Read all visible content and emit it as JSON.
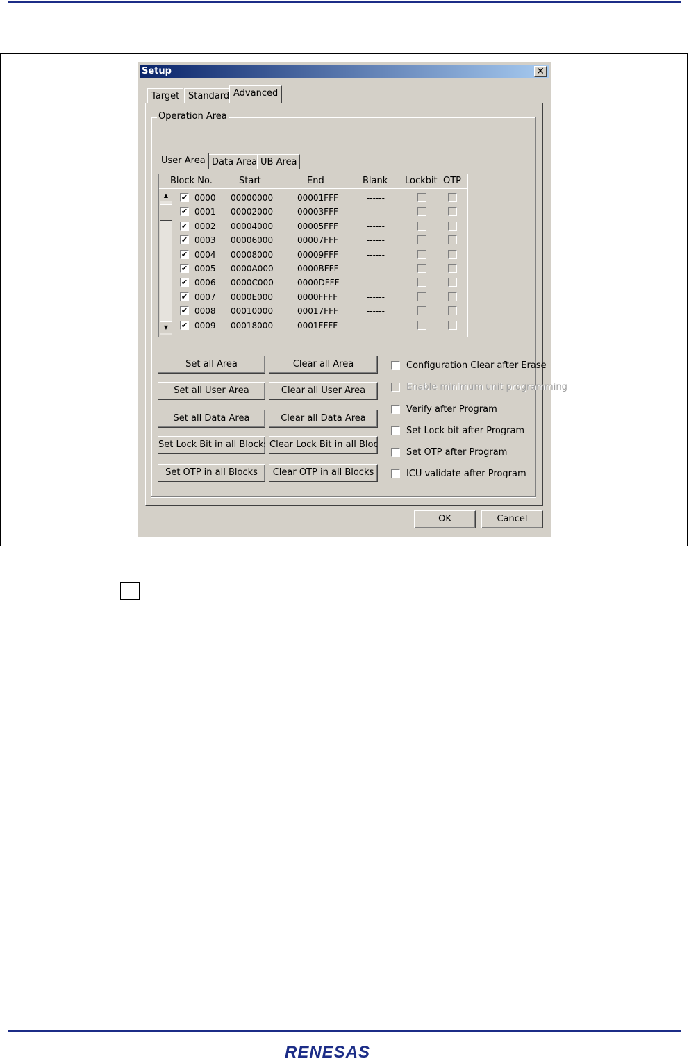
{
  "dialog": {
    "title": "Setup",
    "close_glyph": "✕",
    "tabs": [
      "Target",
      "Standard",
      "Advanced"
    ],
    "active_tab": "Advanced",
    "group_label": "Operation Area",
    "subtabs": [
      "User Area",
      "Data Area",
      "UB Area"
    ],
    "active_subtab": "User Area",
    "columns": [
      "Block No.",
      "Start",
      "End",
      "Blank",
      "Lockbit",
      "OTP"
    ],
    "rows": [
      {
        "block": "0000",
        "start": "00000000",
        "end": "00001FFF",
        "blank": "------",
        "checked": true
      },
      {
        "block": "0001",
        "start": "00002000",
        "end": "00003FFF",
        "blank": "------",
        "checked": true
      },
      {
        "block": "0002",
        "start": "00004000",
        "end": "00005FFF",
        "blank": "------",
        "checked": true
      },
      {
        "block": "0003",
        "start": "00006000",
        "end": "00007FFF",
        "blank": "------",
        "checked": true
      },
      {
        "block": "0004",
        "start": "00008000",
        "end": "00009FFF",
        "blank": "------",
        "checked": true
      },
      {
        "block": "0005",
        "start": "0000A000",
        "end": "0000BFFF",
        "blank": "------",
        "checked": true
      },
      {
        "block": "0006",
        "start": "0000C000",
        "end": "0000DFFF",
        "blank": "------",
        "checked": true
      },
      {
        "block": "0007",
        "start": "0000E000",
        "end": "0000FFFF",
        "blank": "------",
        "checked": true
      },
      {
        "block": "0008",
        "start": "00010000",
        "end": "00017FFF",
        "blank": "------",
        "checked": true
      },
      {
        "block": "0009",
        "start": "00018000",
        "end": "0001FFFF",
        "blank": "------",
        "checked": true
      }
    ],
    "buttons_left": [
      "Set all Area",
      "Set all User Area",
      "Set all Data Area",
      "Set Lock Bit in all Blocks",
      "Set OTP in all Blocks"
    ],
    "buttons_right": [
      "Clear all Area",
      "Clear all User Area",
      "Clear all Data Area",
      "Clear Lock Bit in all Blocks",
      "Clear OTP in all Blocks"
    ],
    "options": [
      {
        "label": "Configuration Clear after Erase",
        "checked": false,
        "enabled": true
      },
      {
        "label": "Enable minimum unit programming",
        "checked": false,
        "enabled": false
      },
      {
        "label": "Verify after Program",
        "checked": false,
        "enabled": true
      },
      {
        "label": "Set Lock bit after Program",
        "checked": false,
        "enabled": true
      },
      {
        "label": "Set OTP after Program",
        "checked": false,
        "enabled": true
      },
      {
        "label": "ICU validate after Program",
        "checked": false,
        "enabled": true
      }
    ],
    "ok_label": "OK",
    "cancel_label": "Cancel",
    "check_glyph": "✔",
    "scroll_up_glyph": "▲",
    "scroll_down_glyph": "▼"
  },
  "footer": {
    "logo_text": "RENESAS"
  },
  "colors": {
    "rule": "#1c2d87",
    "dialog_face": "#d4d0c8",
    "title_start": "#0a246a",
    "title_end": "#a6caf0"
  }
}
